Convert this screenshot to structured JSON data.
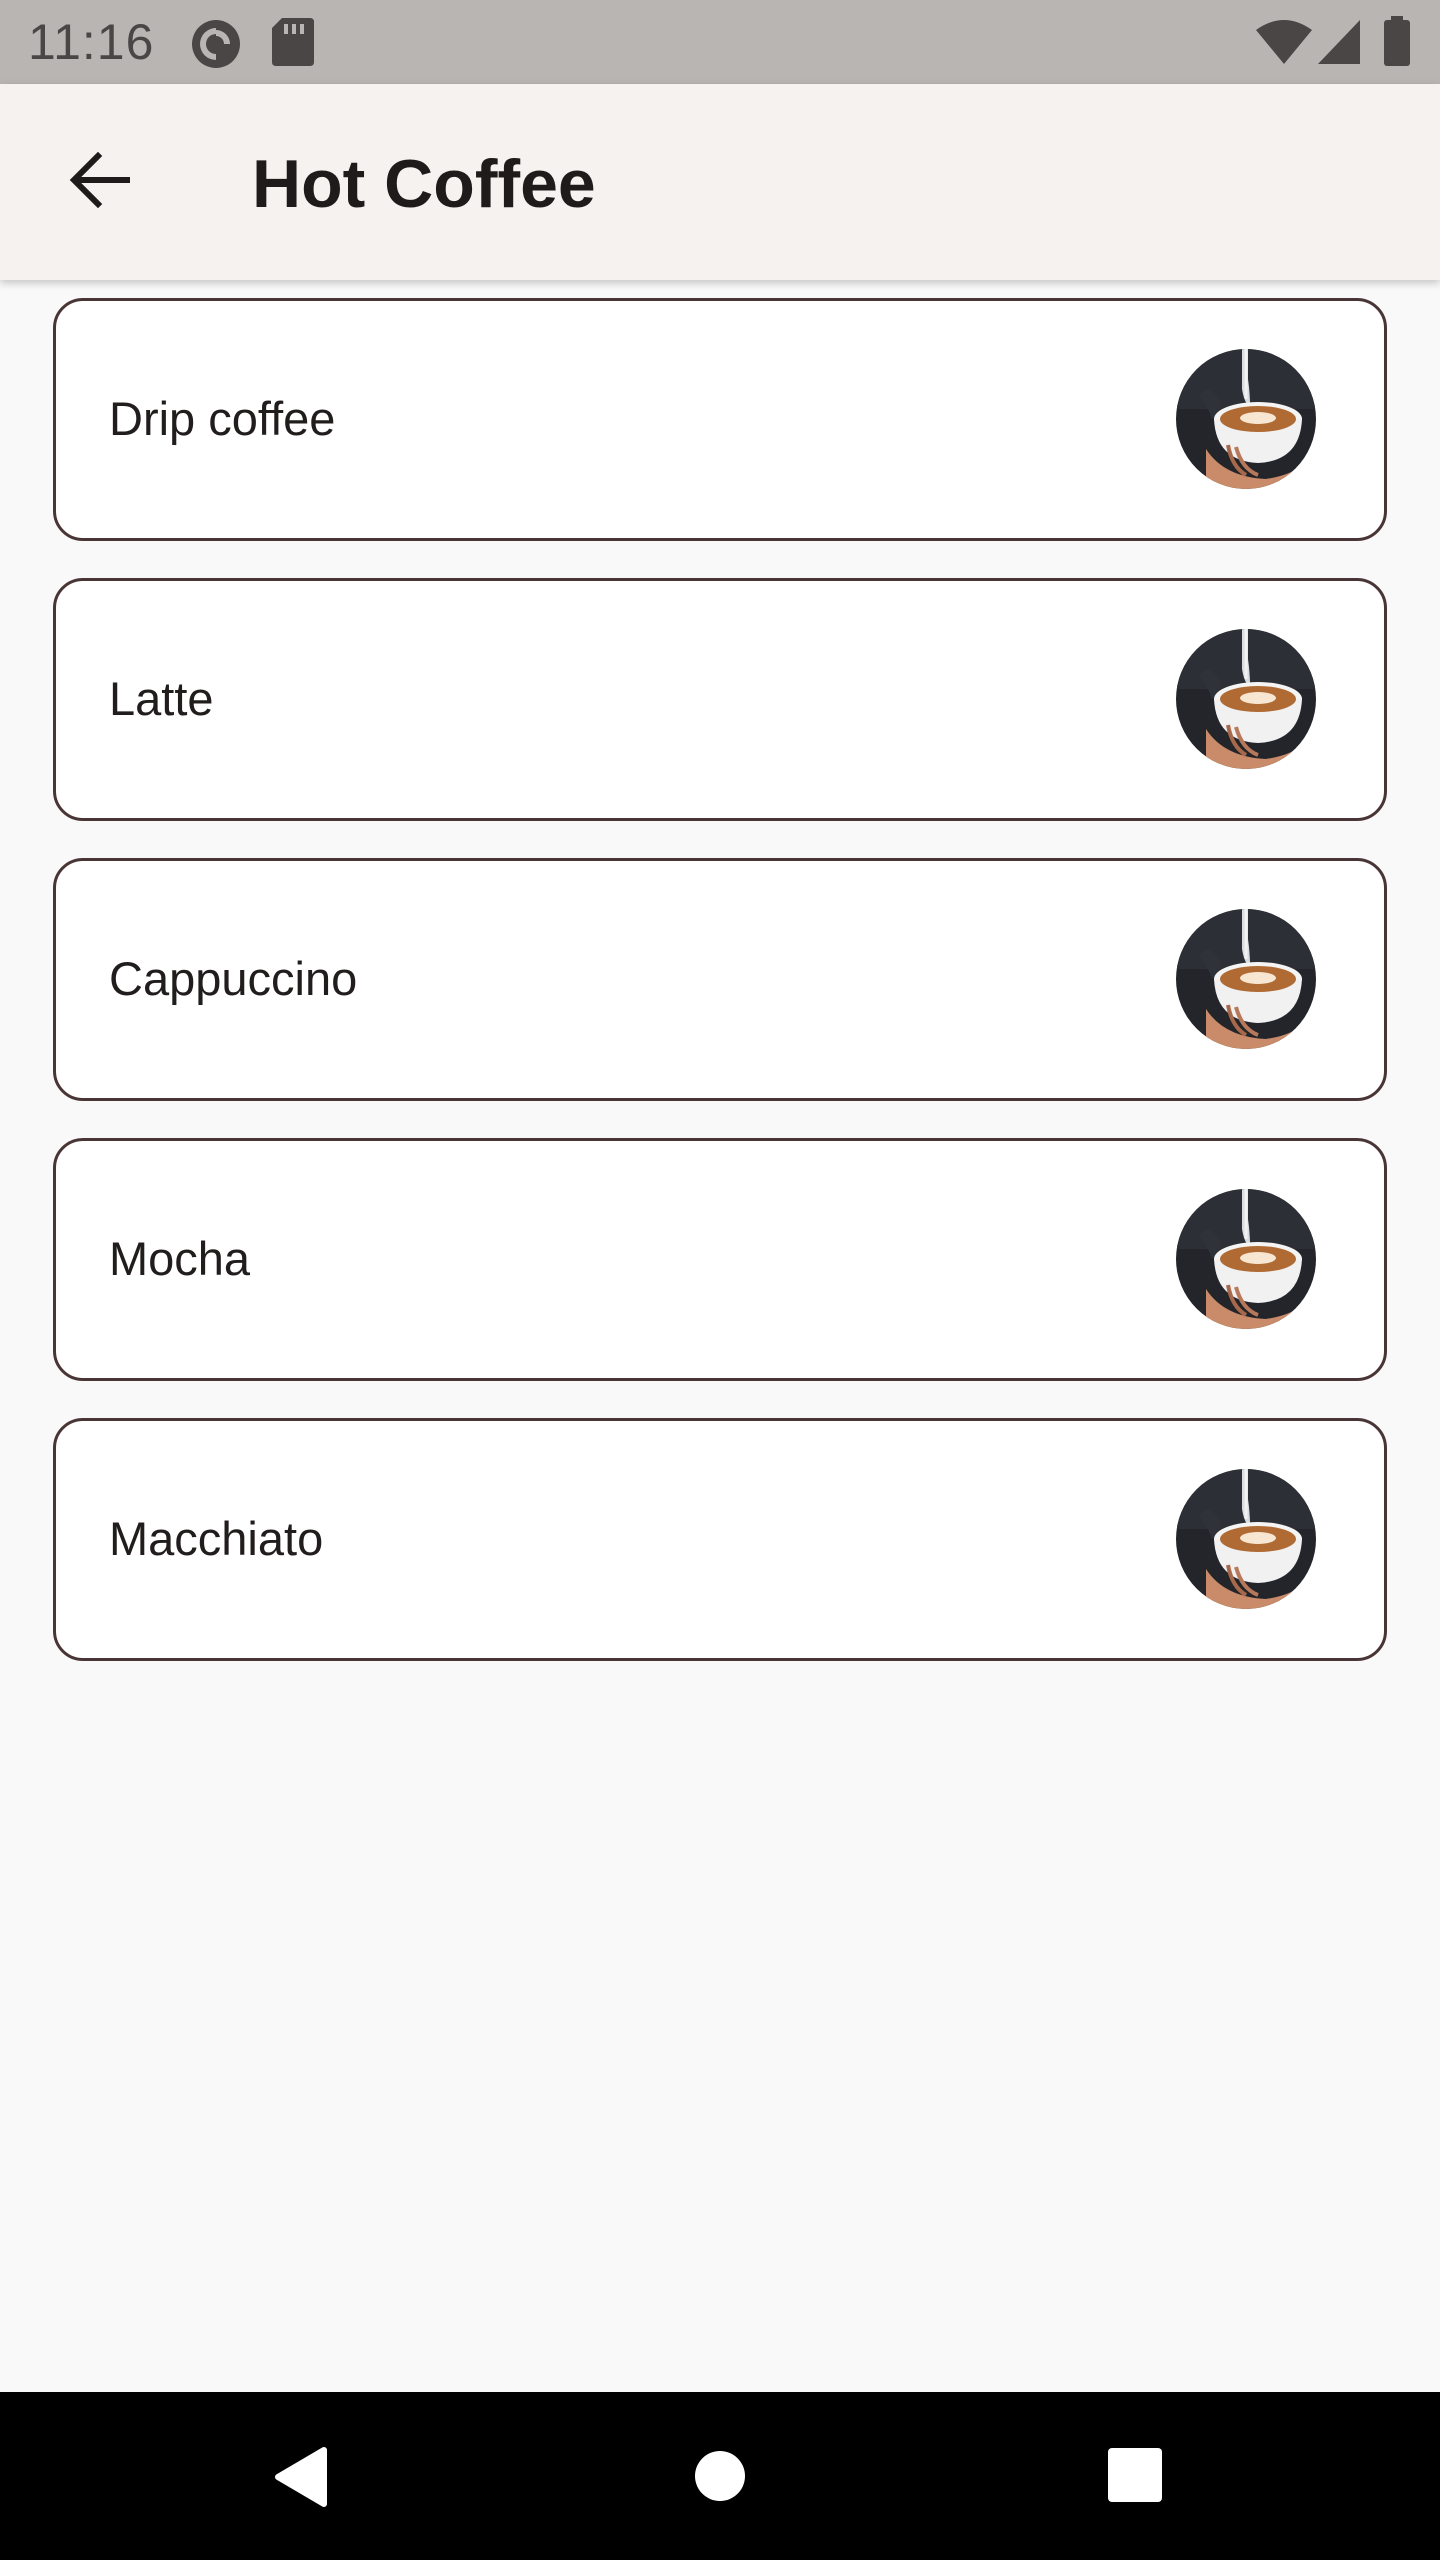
{
  "status_bar": {
    "time": "11:16",
    "icons": [
      "pocket-casts-icon",
      "sd-card-icon",
      "wifi-icon",
      "cell-signal-icon",
      "battery-icon"
    ]
  },
  "app_bar": {
    "back_icon": "arrow-back-icon",
    "title": "Hot Coffee"
  },
  "items": [
    {
      "label": "Drip coffee",
      "image": "latte-art-cup-image"
    },
    {
      "label": "Latte",
      "image": "latte-art-cup-image"
    },
    {
      "label": "Cappuccino",
      "image": "latte-art-cup-image"
    },
    {
      "label": "Mocha",
      "image": "latte-art-cup-image"
    },
    {
      "label": "Macchiato",
      "image": "latte-art-cup-image"
    }
  ],
  "nav_bar": {
    "buttons": [
      "back-triangle-icon",
      "home-circle-icon",
      "recents-square-icon"
    ]
  },
  "colors": {
    "status_bar_bg": "#b9b5b2",
    "app_bar_bg": "#f6f2ef",
    "page_bg": "#faf9f9",
    "card_border": "#4a3536",
    "nav_bar_bg": "#000000"
  }
}
